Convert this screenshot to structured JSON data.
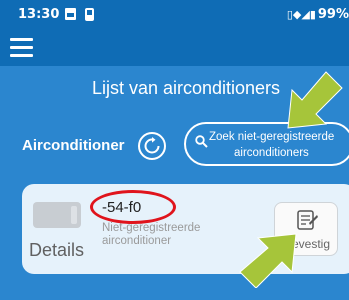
{
  "status_bar": {
    "time": "13:30",
    "battery": "99%"
  },
  "header": {
    "title": "Lijst van airconditioners"
  },
  "section": {
    "label": "Airconditioner",
    "search_button_line1": "Zoek niet-geregistreerde",
    "search_button_line2": "airconditioners"
  },
  "device": {
    "name": "-54-f0",
    "status_line1": "Niet-geregistreerde",
    "status_line2": "airconditioner",
    "details_label": "Details",
    "confirm_label": "Bevestig"
  },
  "colors": {
    "background": "#2b86cf",
    "toolbar": "#0f6cb5",
    "card": "#e6f2fb",
    "highlight": "#e0141c",
    "arrow": "#a6c53a"
  },
  "icons": [
    "menu-icon",
    "refresh-icon",
    "search-icon",
    "document-icon"
  ]
}
